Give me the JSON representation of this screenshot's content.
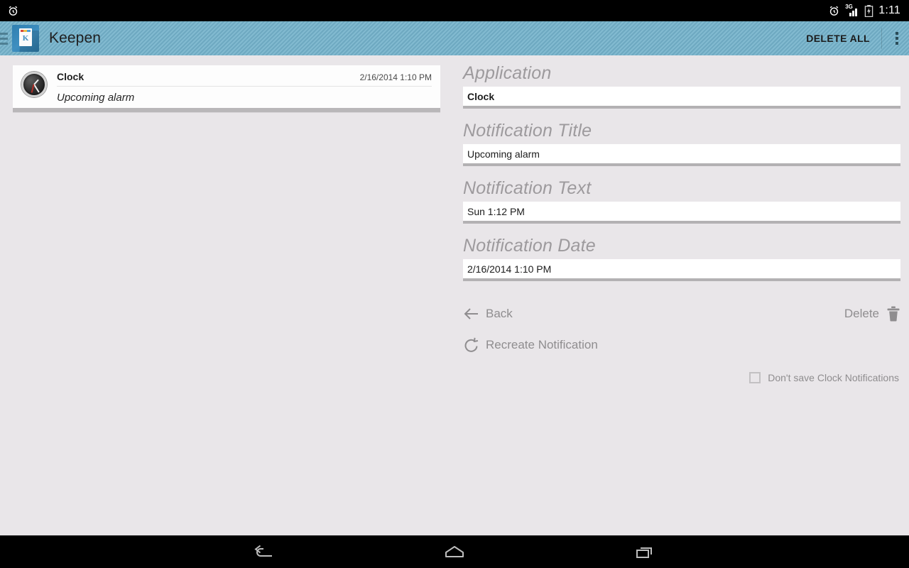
{
  "status_bar": {
    "alarm_icon": "alarm-clock-icon",
    "network_label": "3G",
    "signal_icon": "signal-bars-icon",
    "battery_icon": "battery-charging-icon",
    "time": "1:11"
  },
  "action_bar": {
    "drawer_icon": "drawer-indicator-icon",
    "app_icon": "keepen-app-icon",
    "app_icon_letter": "K",
    "title": "Keepen",
    "delete_all_label": "DELETE ALL",
    "overflow_icon": "overflow-menu-icon"
  },
  "notification_list": {
    "items": [
      {
        "icon": "clock-app-icon",
        "app": "Clock",
        "timestamp": "2/16/2014 1:10 PM",
        "text": "Upcoming alarm"
      }
    ]
  },
  "detail": {
    "fields": [
      {
        "label": "Application",
        "value": "Clock",
        "bold": true
      },
      {
        "label": "Notification Title",
        "value": "Upcoming alarm",
        "bold": false
      },
      {
        "label": "Notification Text",
        "value": "Sun 1:12 PM",
        "bold": false
      },
      {
        "label": "Notification Date",
        "value": "2/16/2014 1:10 PM",
        "bold": false
      }
    ],
    "actions": {
      "back_label": "Back",
      "back_icon": "arrow-left-icon",
      "delete_label": "Delete",
      "delete_icon": "trash-icon",
      "recreate_label": "Recreate Notification",
      "recreate_icon": "refresh-counterclockwise-icon"
    },
    "checkbox": {
      "label": "Don't save Clock Notifications",
      "checked": false
    }
  },
  "nav_bar": {
    "back_icon": "nav-back-icon",
    "home_icon": "nav-home-icon",
    "recents_icon": "nav-recents-icon"
  },
  "colors": {
    "action_bar": "#74b2cb",
    "page_background": "#e9e6e9",
    "label_gray": "#9d9a9d",
    "field_underline": "#b3b1b3"
  }
}
